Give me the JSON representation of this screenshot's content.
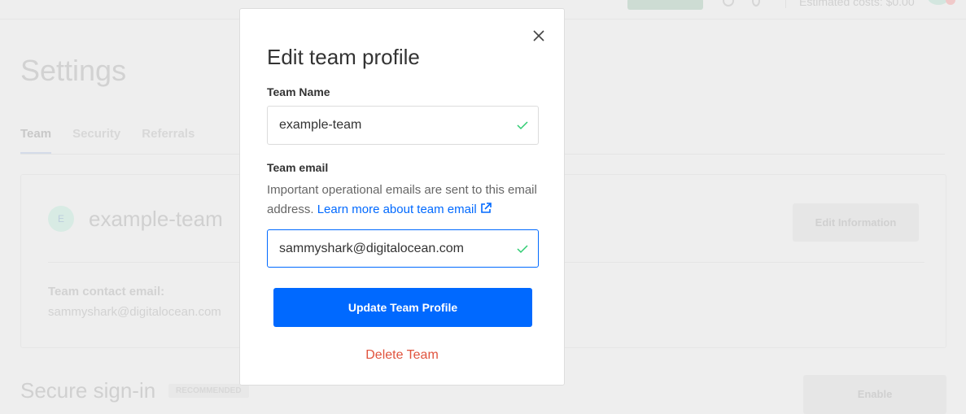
{
  "background": {
    "header": {
      "estimated_costs": "Estimated costs: $0.00"
    },
    "page_title": "Settings",
    "tabs": [
      {
        "label": "Team",
        "active": true
      },
      {
        "label": "Security"
      },
      {
        "label": "Referrals"
      }
    ],
    "team_card": {
      "avatar_initial": "E",
      "team_name": "example-team",
      "edit_button": "Edit Information",
      "contact_label": "Team contact email:",
      "contact_value": "sammyshark@digitalocean.com"
    },
    "secure_signin": {
      "title": "Secure sign-in",
      "badge": "RECOMMENDED",
      "button": "Enable"
    }
  },
  "modal": {
    "title": "Edit team profile",
    "team_name_label": "Team Name",
    "team_name_value": "example-team",
    "team_email_label": "Team email",
    "help_text": "Important operational emails are sent to this email address.",
    "help_link": "Learn more about team email",
    "team_email_value": "sammyshark@digitalocean.com",
    "submit_button": "Update Team Profile",
    "delete_link": "Delete Team"
  },
  "colors": {
    "primary": "#0069ff",
    "danger": "#e0533d",
    "valid": "#2ecc71"
  }
}
